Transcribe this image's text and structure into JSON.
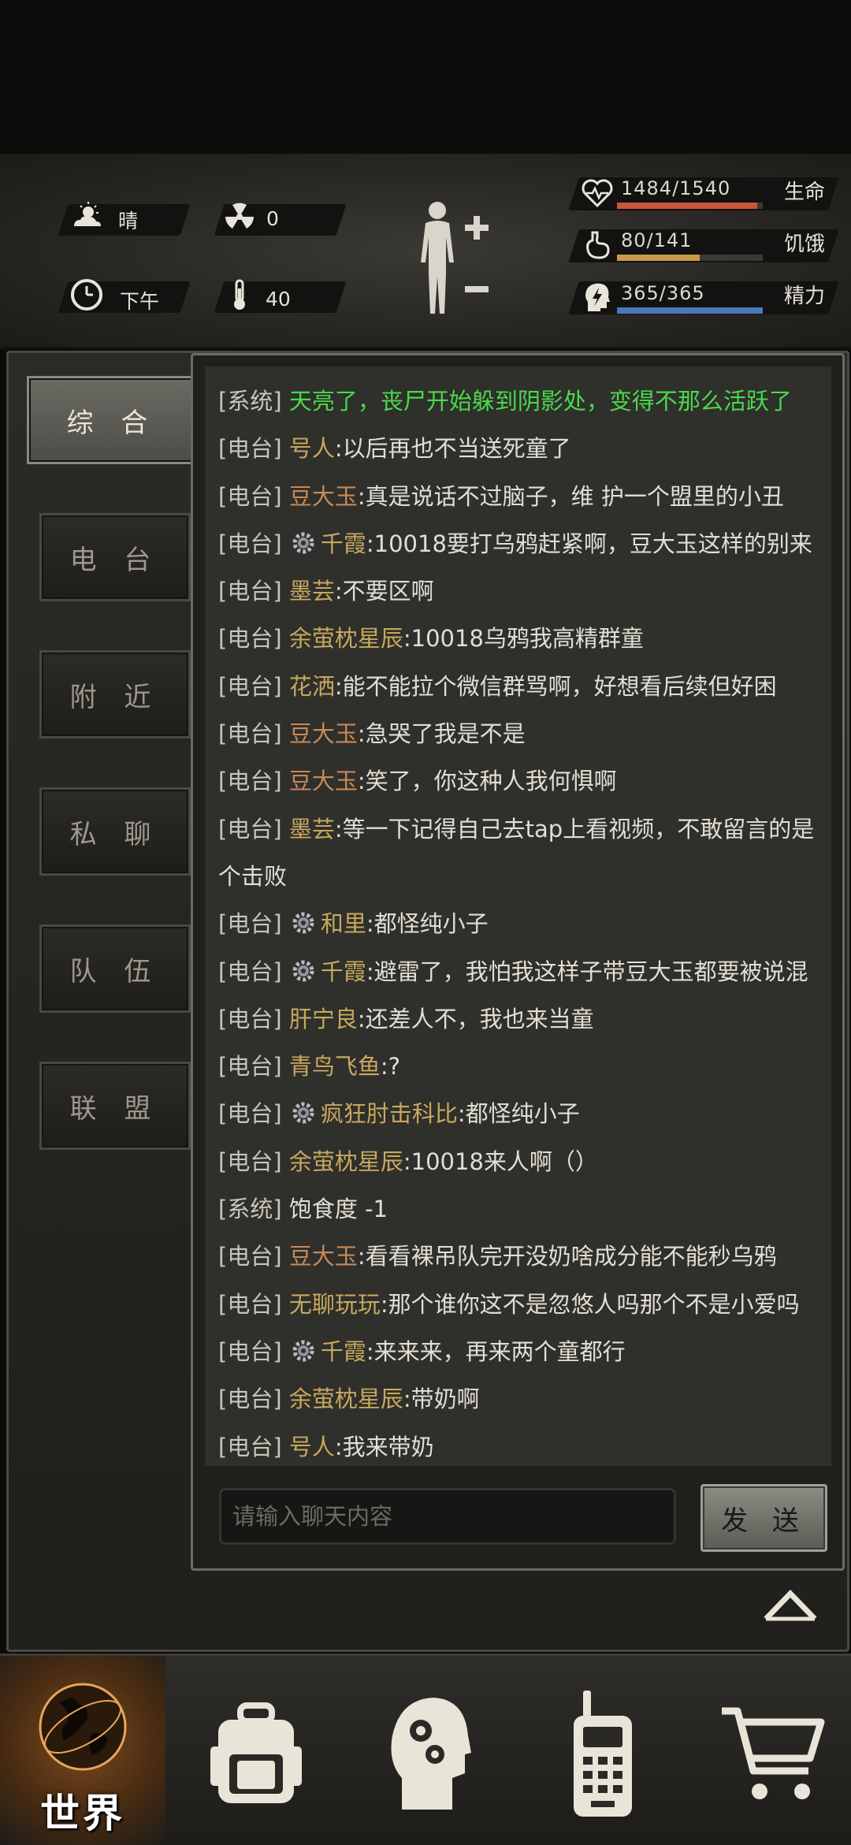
{
  "status": {
    "weather": "晴",
    "radiation": "0",
    "time_of_day": "下午",
    "temperature": "40",
    "health": {
      "label": "生命",
      "value": "1484/1540",
      "ratio": 0.964,
      "color": "#c9573f"
    },
    "hunger": {
      "label": "饥饿",
      "value": "80/141",
      "ratio": 0.567,
      "color": "#c79a4a"
    },
    "energy": {
      "label": "精力",
      "value": "365/365",
      "ratio": 1.0,
      "color": "#4d79b8"
    }
  },
  "tabs": [
    "综 合",
    "电 台",
    "附 近",
    "私 聊",
    "队 伍",
    "联 盟"
  ],
  "messages": [
    {
      "channel": "[系统]",
      "name": "",
      "text": "天亮了，丧尸开始躲到阴影处，变得不那么活跃了",
      "green": true
    },
    {
      "channel": "[电台]",
      "name": "号人",
      "text": ":以后再也不当送死童了"
    },
    {
      "channel": "[电台]",
      "name": "豆大玉",
      "text": ":真是说话不过脑子，维 护一个盟里的小丑",
      "brown": true
    },
    {
      "channel": "[电台]",
      "name": "千霞",
      "text": ":10018要打乌鸦赶紧啊，豆大玉这样的别来",
      "gear": true
    },
    {
      "channel": "[电台]",
      "name": "墨芸",
      "text": ":不要区啊"
    },
    {
      "channel": "[电台]",
      "name": "余萤枕星辰",
      "text": ":10018乌鸦我高精群童"
    },
    {
      "channel": "[电台]",
      "name": "花洒",
      "text": ":能不能拉个微信群骂啊，好想看后续但好困"
    },
    {
      "channel": "[电台]",
      "name": "豆大玉",
      "text": ":急哭了我是不是",
      "brown": true
    },
    {
      "channel": "[电台]",
      "name": "豆大玉",
      "text": ":笑了，你这种人我何惧啊",
      "brown": true
    },
    {
      "channel": "[电台]",
      "name": "墨芸",
      "text": ":等一下记得自己去tap上看视频，不敢留言的是个击败"
    },
    {
      "channel": "[电台]",
      "name": "和里",
      "text": ":都怪纯小子",
      "gear": true
    },
    {
      "channel": "[电台]",
      "name": "千霞",
      "text": ":避雷了，我怕我这样子带豆大玉都要被说混",
      "gear": true
    },
    {
      "channel": "[电台]",
      "name": "肝宁良",
      "text": ":还差人不，我也来当童"
    },
    {
      "channel": "[电台]",
      "name": "青鸟飞鱼",
      "text": ":?"
    },
    {
      "channel": "[电台]",
      "name": "疯狂肘击科比",
      "text": ":都怪纯小子",
      "gear": true
    },
    {
      "channel": "[电台]",
      "name": "余萤枕星辰",
      "text": ":10018来人啊（）"
    },
    {
      "channel": "[系统]",
      "name": "",
      "text": "饱食度 -1"
    },
    {
      "channel": "[电台]",
      "name": "豆大玉",
      "text": ":看看裸吊队完开没奶啥成分能不能秒乌鸦",
      "brown": true
    },
    {
      "channel": "[电台]",
      "name": "无聊玩玩",
      "text": ":那个谁你这不是忽悠人吗那个不是小爱吗"
    },
    {
      "channel": "[电台]",
      "name": "千霞",
      "text": ":来来来，再来两个童都行",
      "gear": true
    },
    {
      "channel": "[电台]",
      "name": "余萤枕星辰",
      "text": ":带奶啊"
    },
    {
      "channel": "[电台]",
      "name": "号人",
      "text": ":我来带奶"
    }
  ],
  "chat": {
    "placeholder": "请输入聊天内容",
    "send_label": "发 送"
  },
  "nav": {
    "world_label": "世界",
    "items": [
      "world-globe-icon",
      "backpack-icon",
      "skills-head-icon",
      "radio-walkie-icon",
      "shop-cart-icon"
    ]
  }
}
